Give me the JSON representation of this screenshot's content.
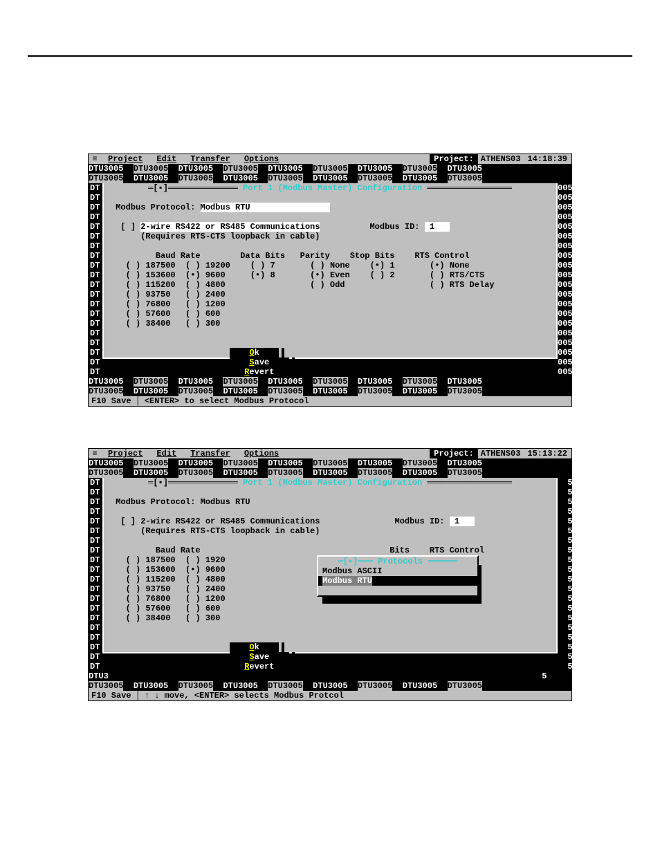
{
  "menu": {
    "app_icon": "≡",
    "items": [
      "Project",
      "Edit",
      "Transfer",
      "Options"
    ],
    "project_label": "Project:",
    "project_name": "ATHENS03"
  },
  "clock1": "14:18:39",
  "clock2": "15:13:22",
  "tile_word": "DTU3005",
  "tile_suffix": "005",
  "dialog": {
    "title": "Port 1 (Modbus Master) Configuration",
    "close_glyph": "[▪]",
    "field_protocol_label": "Modbus Protocol:",
    "field_protocol_value": "Modbus RTU",
    "cb_unchecked": "[ ]",
    "cb_label": "2-wire RS422 or RS485 Communications",
    "cb_note": "(Requires RTS-CTS loopback in cable)",
    "modbus_id_label": "Modbus ID:",
    "modbus_id_value": "1",
    "headers": {
      "baud": "Baud Rate",
      "databits": "Data Bits",
      "parity": "Parity",
      "stopbits": "Stop Bits",
      "rts": "RTS Control",
      "bits": "Bits"
    },
    "baud_col1": [
      "187500",
      "153600",
      "115200",
      "93750",
      "76800",
      "57600",
      "38400"
    ],
    "baud_col2": [
      "19200",
      "9600",
      "4800",
      "2400",
      "1200",
      "600",
      "300"
    ],
    "baud_col2_trunc": [
      "1920",
      "9600",
      "4800",
      "2400",
      "1200",
      "600",
      "300"
    ],
    "baud_selected": "9600",
    "data_bits": [
      "7",
      "8"
    ],
    "data_bits_selected": "8",
    "parity": [
      "None",
      "Even",
      "Odd"
    ],
    "parity_selected": "Even",
    "stop_bits": [
      "1",
      "2"
    ],
    "stop_bits_selected": "1",
    "rts": [
      "None",
      "RTS/CTS",
      "RTS Delay"
    ],
    "rts_selected": "None",
    "buttons": {
      "ok": "Ok",
      "ok_hot": "O",
      "save": "ave",
      "save_hot": "S",
      "revert": "evert",
      "revert_hot": "R"
    }
  },
  "popup": {
    "title": "Protocols",
    "opts": [
      "Modbus ASCII",
      "Modbus RTU"
    ],
    "selected": "Modbus RTU"
  },
  "status1_left": "F10 Save",
  "status1_right": "<ENTER> to select Modbus Protocol",
  "status2_left": "F10 Save",
  "status2_right": "↑ ↓ move, <ENTER> selects Modbus Protcol",
  "side_left_label": "DT",
  "side_right_label_005": "005",
  "side_right_label_5": "5",
  "side_right_label_DTU3": "DTU3"
}
